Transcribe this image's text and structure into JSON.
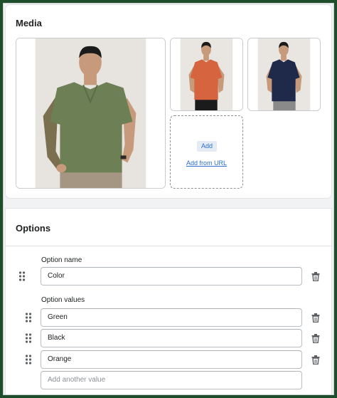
{
  "media": {
    "title": "Media",
    "images": [
      {
        "name": "green-polo-image",
        "shirt_color": "#6d7f55"
      },
      {
        "name": "orange-polo-image",
        "shirt_color": "#d5643f"
      },
      {
        "name": "navy-polo-image",
        "shirt_color": "#1f2a4a"
      }
    ],
    "add_label": "Add",
    "add_from_url_label": "Add from URL"
  },
  "options": {
    "title": "Options",
    "option_name_label": "Option name",
    "option_name_value": "Color",
    "option_values_label": "Option values",
    "values": [
      "Green",
      "Black",
      "Orange"
    ],
    "add_another_placeholder": "Add another value"
  },
  "colors": {
    "link": "#2c6ecb",
    "frame": "#1d4d2b"
  },
  "icons": {
    "drag": "drag-handle-icon",
    "delete": "trash-icon"
  }
}
